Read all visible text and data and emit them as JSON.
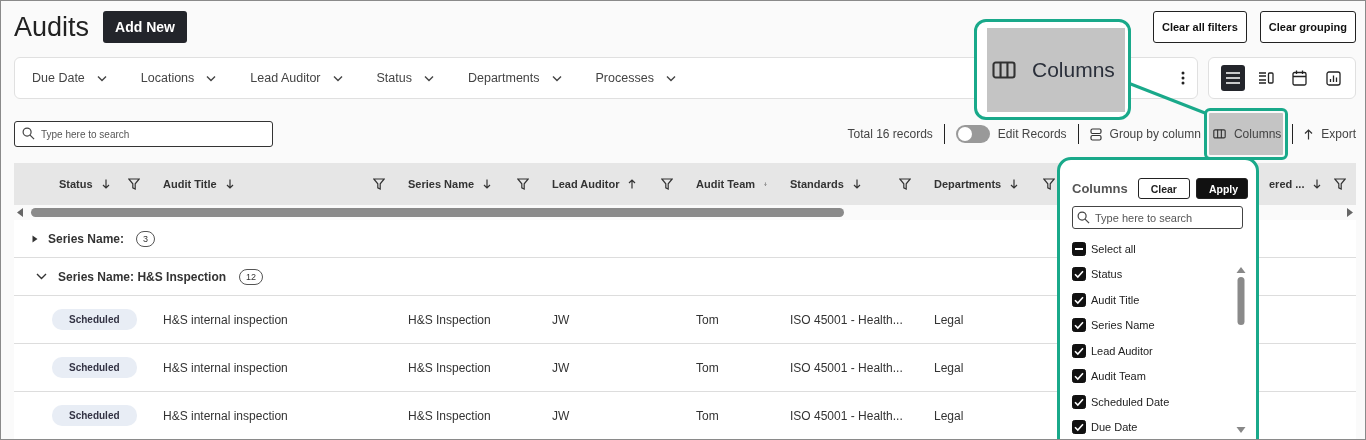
{
  "page": {
    "title": "Audits",
    "add_button": "Add New",
    "clear_filters": "Clear all filters",
    "clear_grouping": "Clear grouping"
  },
  "filters": [
    {
      "label": "Due Date"
    },
    {
      "label": "Locations"
    },
    {
      "label": "Lead Auditor"
    },
    {
      "label": "Status"
    },
    {
      "label": "Departments"
    },
    {
      "label": "Processes"
    }
  ],
  "views": [
    {
      "kind": "list",
      "selected": true
    },
    {
      "kind": "detail",
      "selected": false
    },
    {
      "kind": "calendar",
      "selected": false
    },
    {
      "kind": "chart",
      "selected": false
    }
  ],
  "search": {
    "placeholder": "Type here to search"
  },
  "toolbar": {
    "total": "Total 16 records",
    "edit_records": {
      "label": "Edit Records",
      "on": false
    },
    "group_by": "Group by column",
    "columns": {
      "label": "Columns",
      "highlighted": true
    },
    "export": "Export"
  },
  "table": {
    "columns": [
      {
        "label": "Status",
        "sort_ascending": false,
        "filter": true
      },
      {
        "label": "Audit Title",
        "sort_ascending": false,
        "filter": true
      },
      {
        "label": "Series Name",
        "sort_ascending": false,
        "filter": true
      },
      {
        "label": "Lead Auditor",
        "sort_ascending": true,
        "filter": true
      },
      {
        "label": "Audit Team",
        "sort_ascending": false,
        "filter": false
      },
      {
        "label": "Standards",
        "sort_ascending": false,
        "filter": true
      },
      {
        "label": "Departments",
        "sort_ascending": false,
        "filter": true
      },
      {
        "label": "ered ...",
        "sort_ascending": false,
        "filter": true
      }
    ],
    "groups": [
      {
        "label": "Series Name:",
        "count": "3",
        "expanded": false
      },
      {
        "label": "Series Name: H&S Inspection",
        "count": "12",
        "expanded": true,
        "rows": [
          {
            "status": "Scheduled",
            "cells": [
              "H&S internal inspection",
              "H&S Inspection",
              "JW",
              "Tom",
              "ISO 45001 - Health...",
              "Legal"
            ]
          },
          {
            "status": "Scheduled",
            "cells": [
              "H&S internal inspection",
              "H&S Inspection",
              "JW",
              "Tom",
              "ISO 45001 - Health...",
              "Legal"
            ]
          },
          {
            "status": "Scheduled",
            "cells": [
              "H&S internal inspection",
              "H&S Inspection",
              "JW",
              "Tom",
              "ISO 45001 - Health...",
              "Legal"
            ]
          }
        ]
      }
    ]
  },
  "callout": {
    "label": "Columns"
  },
  "columns_panel": {
    "title": "Columns",
    "clear": "Clear",
    "apply": "Apply",
    "search_placeholder": "Type here to search",
    "select_all": {
      "label": "Select all",
      "indeterminate": true
    },
    "items": [
      {
        "label": "Status",
        "checked": true
      },
      {
        "label": "Audit Title",
        "checked": true
      },
      {
        "label": "Series Name",
        "checked": true
      },
      {
        "label": "Lead Auditor",
        "checked": true
      },
      {
        "label": "Audit Team",
        "checked": true
      },
      {
        "label": "Scheduled Date",
        "checked": true
      },
      {
        "label": "Due Date",
        "checked": true
      }
    ]
  }
}
